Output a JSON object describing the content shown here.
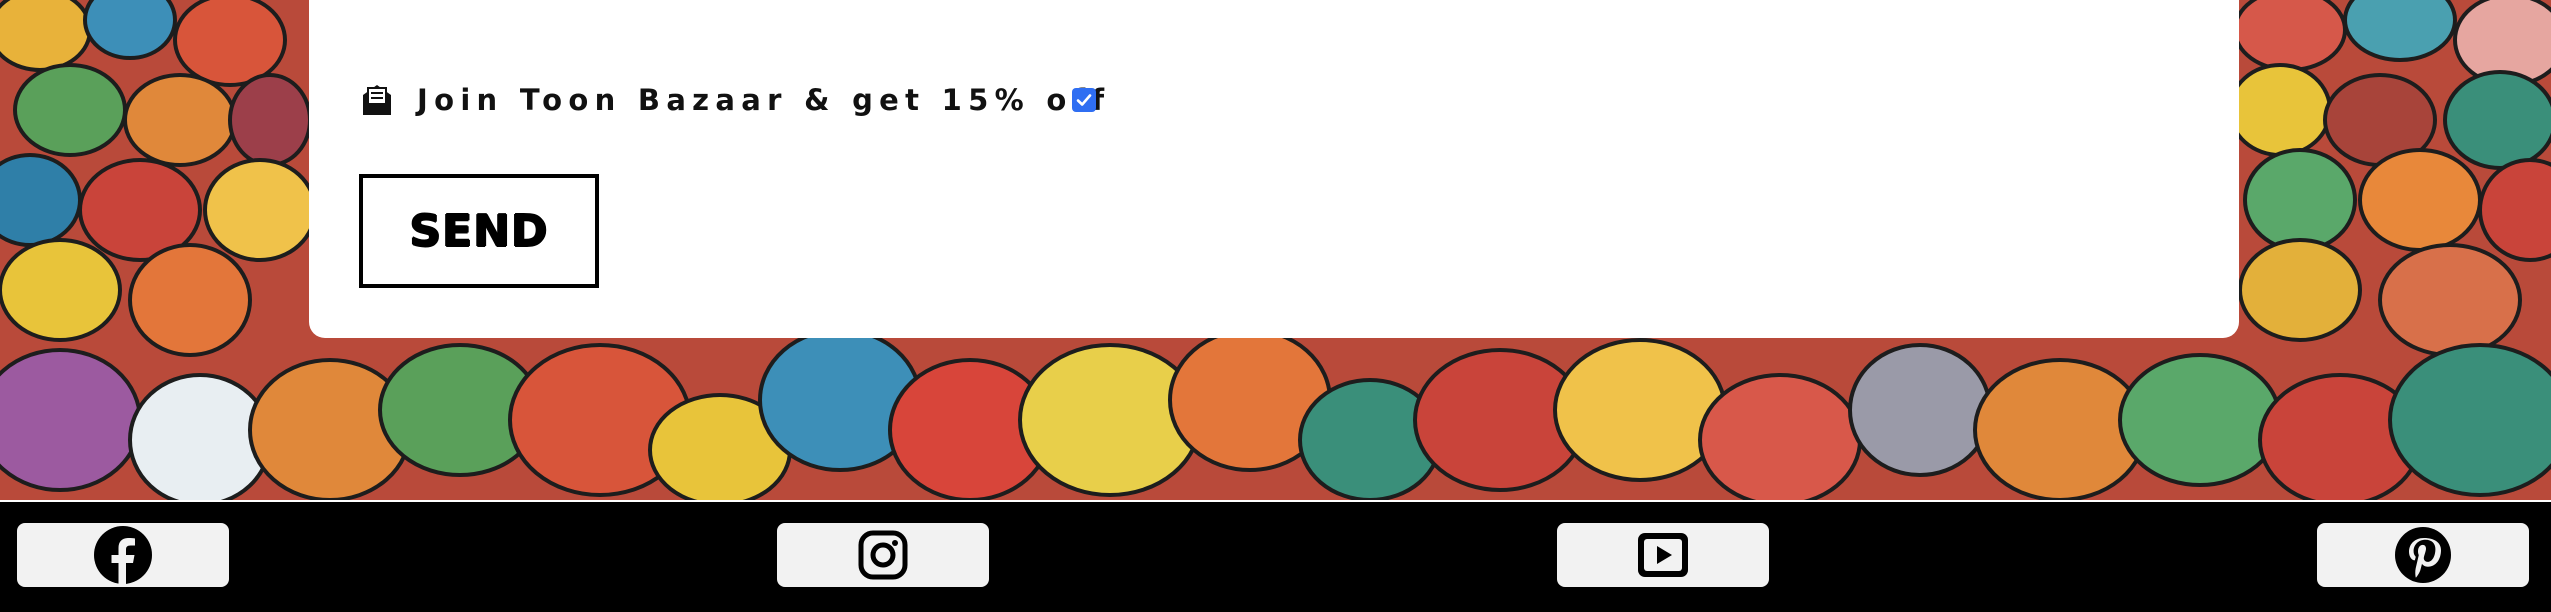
{
  "newsletter": {
    "optin_label": "Join Toon Bazaar & get 15% off",
    "optin_checked": true,
    "send_label": "SEND"
  },
  "social": [
    {
      "name": "facebook",
      "icon": "facebook-icon"
    },
    {
      "name": "instagram",
      "icon": "instagram-icon"
    },
    {
      "name": "youtube",
      "icon": "youtube-icon"
    },
    {
      "name": "pinterest",
      "icon": "pinterest-icon"
    }
  ],
  "colors": {
    "card": "#ffffff",
    "footer": "#000000",
    "checkbox_accent": "#2f6ef2"
  }
}
